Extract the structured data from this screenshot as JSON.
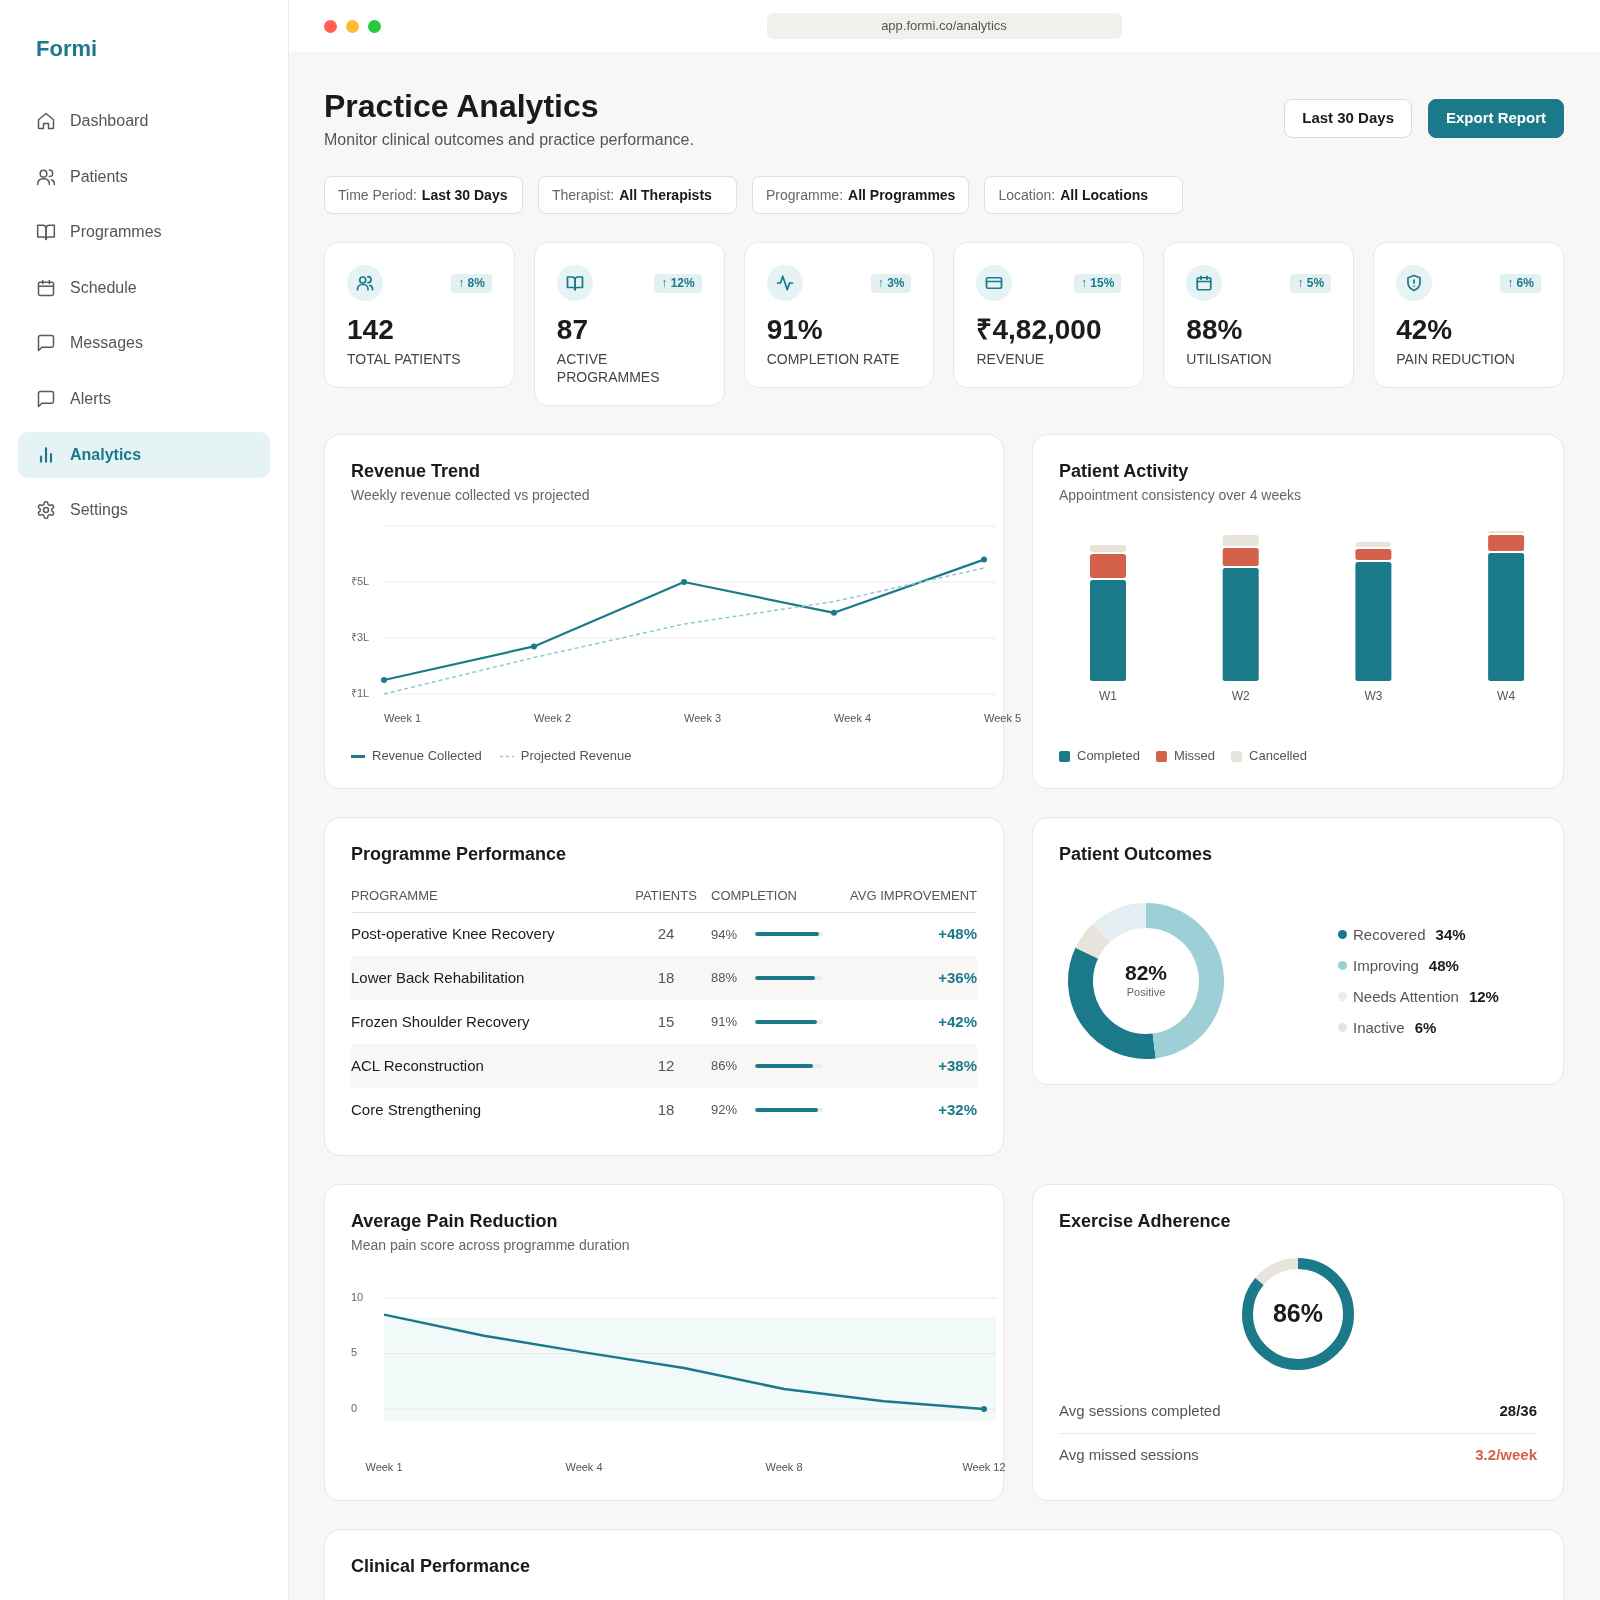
{
  "sidebar": {
    "logo": "Formi",
    "items": [
      {
        "label": "Dashboard",
        "selected": false
      },
      {
        "label": "Patients",
        "selected": false
      },
      {
        "label": "Programmes",
        "selected": false
      },
      {
        "label": "Schedule",
        "selected": false
      },
      {
        "label": "Messages",
        "selected": false
      },
      {
        "label": "Alerts",
        "selected": false
      },
      {
        "label": "Analytics",
        "selected": true
      },
      {
        "label": "Settings",
        "selected": false
      }
    ]
  },
  "browser": {
    "url": "app.formi.co/analytics"
  },
  "header": {
    "title": "Practice Analytics",
    "subtitle": "Monitor clinical outcomes and practice performance.",
    "buttons": [
      {
        "label": "Last 30 Days",
        "kind": "outline"
      },
      {
        "label": "Export Report",
        "kind": "primary"
      }
    ]
  },
  "filters": [
    {
      "label": "Time Period:",
      "value": "Last 30 Days"
    },
    {
      "label": "Therapist:",
      "value": "All Therapists"
    },
    {
      "label": "Programme:",
      "value": "All Programmes"
    },
    {
      "label": "Location:",
      "value": "All Locations"
    }
  ],
  "kpis": [
    {
      "value": "142",
      "label": "TOTAL PATIENTS",
      "change": "↑ 8%"
    },
    {
      "value": "87",
      "label": "ACTIVE PROGRAMMES",
      "change": "↑ 12%"
    },
    {
      "value": "91%",
      "label": "COMPLETION RATE",
      "change": "↑ 3%"
    },
    {
      "value": "₹4,82,000",
      "label": "REVENUE",
      "change": "↑ 15%"
    },
    {
      "value": "88%",
      "label": "UTILISATION",
      "change": "↑ 5%"
    },
    {
      "value": "42%",
      "label": "PAIN REDUCTION",
      "change": "↑ 6%"
    }
  ],
  "revenue_trend": {
    "title": "Revenue Trend",
    "subtitle": "Weekly revenue collected vs projected",
    "chart_data": {
      "type": "line",
      "categories": [
        "Week 1",
        "Week 2",
        "Week 3",
        "Week 4",
        "Week 5"
      ],
      "series": [
        {
          "name": "Revenue Collected",
          "color": "#1b7a8a",
          "values": [
            1.5,
            2.7,
            5.0,
            3.9,
            5.8
          ],
          "line_style": "solid",
          "marker": "circle"
        },
        {
          "name": "Projected Revenue",
          "color": "#8fc9d1",
          "values": [
            1.0,
            2.3,
            3.5,
            4.3,
            5.5
          ],
          "line_style": "dashed"
        }
      ],
      "ylim": [
        1,
        7
      ],
      "yticks": [
        {
          "value": 1,
          "label": "₹1L"
        },
        {
          "value": 3,
          "label": "₹3L"
        },
        {
          "value": 5,
          "label": "₹5L"
        }
      ]
    }
  },
  "patient_activity": {
    "title": "Patient Activity",
    "subtitle": "Appointment consistency over 4 weeks",
    "categories": [
      "W1",
      "W2",
      "W3",
      "W4"
    ],
    "legend": [
      {
        "label": "Completed",
        "color": "#1b7a8a"
      },
      {
        "label": "Missed",
        "color": "#d4614a"
      },
      {
        "label": "Cancelled",
        "color": "#e8e4dc"
      }
    ]
  },
  "programme_performance": {
    "title": "Programme Performance",
    "columns": [
      "PROGRAMME",
      "PATIENTS",
      "COMPLETION",
      "AVG IMPROVEMENT"
    ],
    "rows": [
      {
        "name": "Post-operative Knee Recovery",
        "patients": "24",
        "completion": "94%",
        "level": 0.94,
        "improvement": "+48%"
      },
      {
        "name": "Lower Back Rehabilitation",
        "patients": "18",
        "completion": "88%",
        "level": 0.88,
        "improvement": "+36%"
      },
      {
        "name": "Frozen Shoulder Recovery",
        "patients": "15",
        "completion": "91%",
        "level": 0.91,
        "improvement": "+42%"
      },
      {
        "name": "ACL Reconstruction",
        "patients": "12",
        "completion": "86%",
        "level": 0.86,
        "improvement": "+38%"
      },
      {
        "name": "Core Strengthening",
        "patients": "18",
        "completion": "92%",
        "level": 0.92,
        "improvement": "+32%"
      }
    ]
  },
  "patient_outcomes": {
    "title": "Patient Outcomes",
    "center_value": "82%",
    "center_label": "Positive",
    "chart_data": {
      "type": "donut",
      "categories": [
        "Recovered",
        "Improving",
        "Needs Attention",
        "Inactive"
      ],
      "values": [
        34,
        48,
        12,
        6
      ],
      "value_labels": [
        "34%",
        "48%",
        "12%",
        "6%"
      ],
      "colors": [
        "#1b7a8a",
        "#9ecfd6",
        "#e3eff2",
        "#e8e4dc"
      ]
    }
  },
  "pain_reduction": {
    "title": "Average Pain Reduction",
    "subtitle": "Mean pain score across programme duration",
    "chart_data": {
      "type": "line",
      "categories": [
        "Week 1",
        null,
        "Week 4",
        null,
        "Week 8",
        null,
        "Week 12"
      ],
      "ylim": [
        0,
        10
      ],
      "yticks": [
        0,
        5,
        10
      ],
      "series": [
        {
          "color": "#1b7a8a",
          "values": [
            8.5,
            6.6,
            5.1,
            3.7,
            1.8,
            0.7,
            0
          ],
          "line_style": "solid"
        }
      ]
    }
  },
  "exercise_adherence": {
    "title": "Exercise Adherence",
    "level": 0.86,
    "value": "86%",
    "stats": [
      {
        "label": "Avg sessions completed",
        "value": "28/36",
        "kind": "plain"
      },
      {
        "label": "Avg missed sessions",
        "value": "3.2/week",
        "kind": "alert"
      }
    ]
  },
  "clinical_performance": {
    "title": "Clinical Performance"
  }
}
